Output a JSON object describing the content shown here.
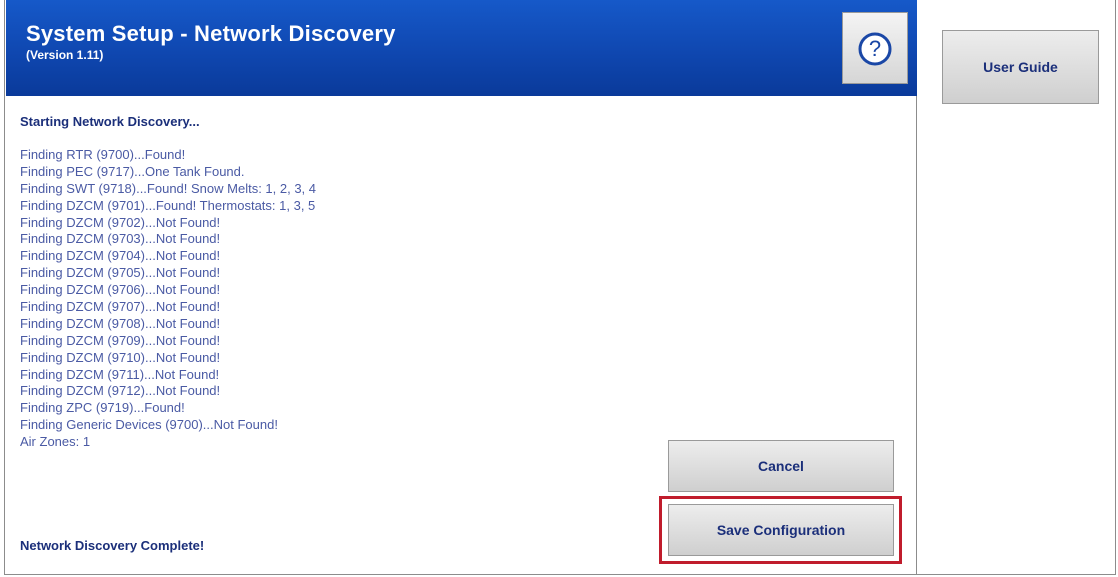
{
  "header": {
    "title": "System Setup - Network Discovery",
    "version": "(Version 1.11)",
    "help_icon": "question-icon",
    "accent_color": "#0f47b0"
  },
  "log": {
    "heading": "Starting Network Discovery...",
    "lines": [
      "Finding RTR (9700)...Found!",
      "Finding PEC (9717)...One Tank Found.",
      "Finding SWT (9718)...Found! Snow Melts: 1, 2, 3, 4",
      "Finding DZCM (9701)...Found! Thermostats: 1, 3, 5",
      "Finding DZCM (9702)...Not Found!",
      "Finding DZCM (9703)...Not Found!",
      "Finding DZCM (9704)...Not Found!",
      "Finding DZCM (9705)...Not Found!",
      "Finding DZCM (9706)...Not Found!",
      "Finding DZCM (9707)...Not Found!",
      "Finding DZCM (9708)...Not Found!",
      "Finding DZCM (9709)...Not Found!",
      "Finding DZCM (9710)...Not Found!",
      "Finding DZCM (9711)...Not Found!",
      "Finding DZCM (9712)...Not Found!",
      "Finding ZPC (9719)...Found!",
      "Finding Generic Devices (9700)...Not Found!",
      "Air Zones: 1"
    ],
    "complete": "Network Discovery Complete!"
  },
  "buttons": {
    "cancel": "Cancel",
    "save": "Save Configuration",
    "user_guide": "User Guide"
  },
  "highlight_color": "#c01c2c"
}
